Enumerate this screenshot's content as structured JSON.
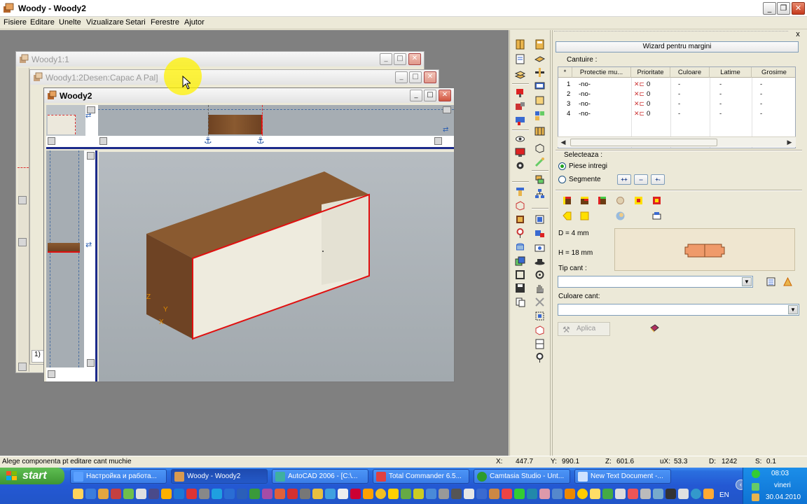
{
  "window": {
    "title": "Woody - Woody2",
    "minimize": "0",
    "restore": "2",
    "close": "r"
  },
  "menu": [
    "Fisiere",
    "Editare",
    "Unelte",
    "Vizualizare",
    "Setari",
    "Ferestre",
    "Ajutor"
  ],
  "children": {
    "w1": "Woody1:1",
    "w2": "Woody1:2Desen:Capac A Pal]",
    "w3": "Woody2",
    "w1_frag": "1)"
  },
  "view": {
    "axis_z": "Z",
    "axis_y": "Y",
    "axis_x": "X"
  },
  "panel": {
    "close": "x",
    "header": "Wizard pentru margini",
    "cantuire_label": "Cantuire :",
    "columns": [
      "*",
      "Protectie mu...",
      "Prioritate",
      "Culoare",
      "Latime",
      "Grosime"
    ],
    "rows": [
      {
        "n": "1",
        "prot": "-no-",
        "prio": "0",
        "cul": "-",
        "lat": "-",
        "gros": "-"
      },
      {
        "n": "2",
        "prot": "-no-",
        "prio": "0",
        "cul": "-",
        "lat": "-",
        "gros": "-"
      },
      {
        "n": "3",
        "prot": "-no-",
        "prio": "0",
        "cul": "-",
        "lat": "-",
        "gros": "-"
      },
      {
        "n": "4",
        "prot": "-no-",
        "prio": "0",
        "cul": "-",
        "lat": "-",
        "gros": "-"
      }
    ],
    "selecteaza": "Selecteaza :",
    "opt_piese": "Piese intregi",
    "opt_segmente": "Segmente",
    "seg_buttons": [
      "++",
      "--",
      "+-"
    ],
    "d_label": "D =   4 mm",
    "h_label": "H =   18 mm",
    "tip_cant": "Tip cant :",
    "culoare_cant": "Culoare cant:",
    "aplica": "Aplica"
  },
  "status": {
    "message": "Alege componenta pt editare cant muchie",
    "x_label": "X:",
    "x_val": "447.7",
    "y_label": "Y:",
    "y_val": "990.1",
    "z_label": "Z:",
    "z_val": "601.6",
    "ux_label": "uX:",
    "ux_val": "53.3",
    "d_label": "D:",
    "d_val": "1242",
    "s_label": "S:",
    "s_val": "0.1"
  },
  "taskbar": {
    "start": "start",
    "tasks": [
      "Настройка и работа...",
      "Woody - Woody2",
      "AutoCAD 2006 - [C:\\...",
      "Total Commander 6.5...",
      "Camtasia Studio - Unt...",
      "New Text Document -..."
    ],
    "lang": "EN",
    "time": "08:03",
    "day": "vineri",
    "date": "30.04.2010"
  },
  "colors": {
    "wood": "#7a4a26",
    "panel_face": "#efece0",
    "edge_red": "#e01010",
    "viewport_bg": "#a6adb3",
    "taskbar": "#2458d3",
    "start_green": "#3d9633",
    "cursor_highlight": "#fff200"
  }
}
